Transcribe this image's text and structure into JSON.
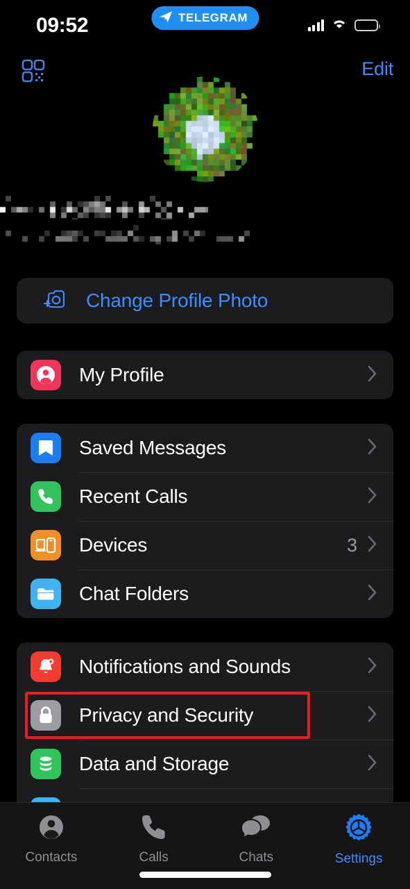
{
  "status_bar": {
    "time": "09:52",
    "dynamic_island": {
      "app_label": "TELEGRAM",
      "icon": "paper-plane-icon",
      "color": "#1f8ff5"
    },
    "cellular_icon": "signal-bars-icon",
    "wifi_icon": "wifi-icon",
    "battery_icon": "battery-low-icon",
    "battery_color": "#f5c518"
  },
  "nav_bar": {
    "qr_icon": "qr-code-icon",
    "edit_label": "Edit",
    "accent_color": "#3c8dff"
  },
  "profile": {
    "avatar_icon": "user-avatar-image",
    "avatar_redacted": true,
    "name_redacted": true,
    "phone_redacted": true
  },
  "change_photo": {
    "label": "Change Profile Photo",
    "icon": "camera-plus-icon",
    "color": "#3c8dff"
  },
  "groups": [
    {
      "id": "profile-group",
      "rows": [
        {
          "id": "my-profile",
          "label": "My Profile",
          "icon": "person-circle-icon",
          "icon_bg": "#f0355b",
          "value": "",
          "chevron": true
        }
      ]
    },
    {
      "id": "chats-group",
      "rows": [
        {
          "id": "saved-messages",
          "label": "Saved Messages",
          "icon": "bookmark-icon",
          "icon_bg": "#1c7ef3",
          "value": "",
          "chevron": true
        },
        {
          "id": "recent-calls",
          "label": "Recent Calls",
          "icon": "phone-icon",
          "icon_bg": "#32c45c",
          "value": "",
          "chevron": true
        },
        {
          "id": "devices",
          "label": "Devices",
          "icon": "devices-icon",
          "icon_bg": "#f09022",
          "value": "3",
          "chevron": true
        },
        {
          "id": "chat-folders",
          "label": "Chat Folders",
          "icon": "folder-icon",
          "icon_bg": "#3fb3ef",
          "value": "",
          "chevron": true
        }
      ]
    },
    {
      "id": "settings-group",
      "rows": [
        {
          "id": "notifications-and-sounds",
          "label": "Notifications and Sounds",
          "icon": "bell-badge-icon",
          "icon_bg": "#f23c32",
          "value": "",
          "chevron": true
        },
        {
          "id": "privacy-and-security",
          "label": "Privacy and Security",
          "icon": "lock-icon",
          "icon_bg": "#9c9ca2",
          "value": "",
          "chevron": true,
          "highlighted": true
        },
        {
          "id": "data-and-storage",
          "label": "Data and Storage",
          "icon": "database-icon",
          "icon_bg": "#32c45c",
          "value": "",
          "chevron": true
        }
      ]
    }
  ],
  "highlight": {
    "target": "privacy-and-security",
    "color": "#ee1b24"
  },
  "tab_bar": {
    "tabs": [
      {
        "id": "contacts",
        "label": "Contacts",
        "icon": "person-icon",
        "active": false
      },
      {
        "id": "calls",
        "label": "Calls",
        "icon": "phone-handset-icon",
        "active": false
      },
      {
        "id": "chats",
        "label": "Chats",
        "icon": "chat-bubbles-icon",
        "active": false
      },
      {
        "id": "settings",
        "label": "Settings",
        "icon": "gear-icon",
        "active": true
      }
    ],
    "active_color": "#3c8dff",
    "inactive_color": "#8e8e93"
  }
}
